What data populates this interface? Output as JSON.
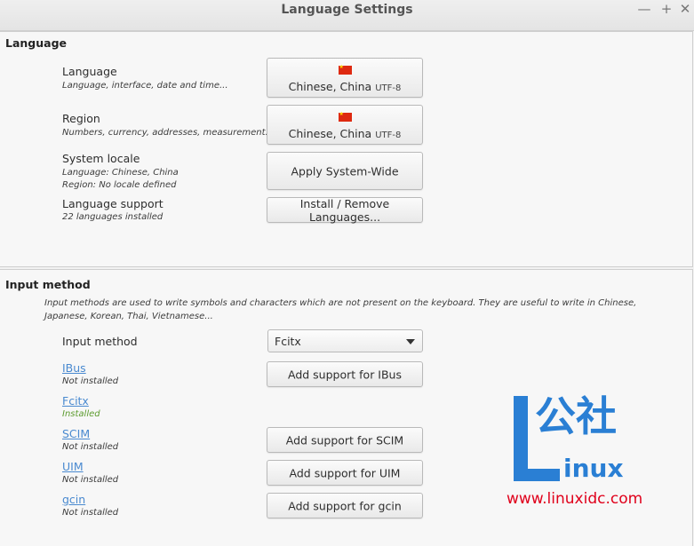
{
  "window": {
    "title": "Language Settings",
    "controls": {
      "minimize": "—",
      "maximize": "+",
      "close": "✕"
    }
  },
  "language_section": {
    "title": "Language",
    "rows": {
      "language": {
        "label": "Language",
        "sub": "Language, interface, date and time...",
        "button": "Chinese, China",
        "encoding": "UTF-8"
      },
      "region": {
        "label": "Region",
        "sub": "Numbers, currency, addresses, measurement...",
        "button": "Chinese, China",
        "encoding": "UTF-8"
      },
      "system_locale": {
        "label": "System locale",
        "sub1": "Language: Chinese, China",
        "sub2": "Region: No locale defined",
        "button": "Apply System-Wide"
      },
      "language_support": {
        "label": "Language support",
        "sub": "22 languages installed",
        "button": "Install / Remove Languages..."
      }
    }
  },
  "input_section": {
    "title": "Input method",
    "description": "Input methods are used to write symbols and characters which are not present on the keyboard. They are useful to write in Chinese, Japanese, Korean, Thai, Vietnamese...",
    "input_method": {
      "label": "Input method",
      "selected": "Fcitx"
    },
    "methods": {
      "ibus": {
        "name": "IBus",
        "status": "Not installed",
        "button": "Add support for IBus"
      },
      "fcitx": {
        "name": "Fcitx",
        "status": "Installed"
      },
      "scim": {
        "name": "SCIM",
        "status": "Not installed",
        "button": "Add support for SCIM"
      },
      "uim": {
        "name": "UIM",
        "status": "Not installed",
        "button": "Add support for UIM"
      },
      "gcin": {
        "name": "gcin",
        "status": "Not installed",
        "button": "Add support for gcin"
      }
    }
  },
  "watermark": {
    "chinese": "公社",
    "inux": "inux",
    "url": "www.linuxidc.com"
  },
  "colors": {
    "link": "#4a8ad0",
    "installed": "#5c9b2e",
    "watermark_blue": "#2a7fd4",
    "watermark_red": "#e0001b"
  }
}
